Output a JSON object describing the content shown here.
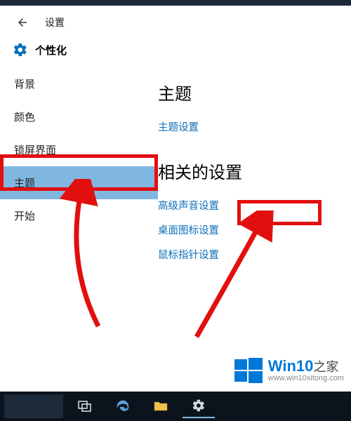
{
  "header": {
    "window_title": "设置"
  },
  "subheader": {
    "title": "个性化"
  },
  "sidebar": {
    "items": [
      {
        "label": "背景"
      },
      {
        "label": "颜色"
      },
      {
        "label": "锁屏界面"
      },
      {
        "label": "主题",
        "selected": true
      },
      {
        "label": "开始"
      }
    ]
  },
  "main": {
    "section1_title": "主题",
    "theme_settings_link": "主题设置",
    "section2_title": "相关的设置",
    "links": {
      "advanced_sound": "高级声音设置",
      "desktop_icon": "桌面图标设置",
      "mouse_pointer": "鼠标指针设置"
    }
  },
  "watermark": {
    "brand": "Win10",
    "brand_suffix": "之家",
    "url": "www.win10xitong.com"
  },
  "colors": {
    "highlight": "#e20f0f",
    "link": "#0b6fb8",
    "selected_bg": "#7fb7e0",
    "accent": "#0078d7"
  }
}
